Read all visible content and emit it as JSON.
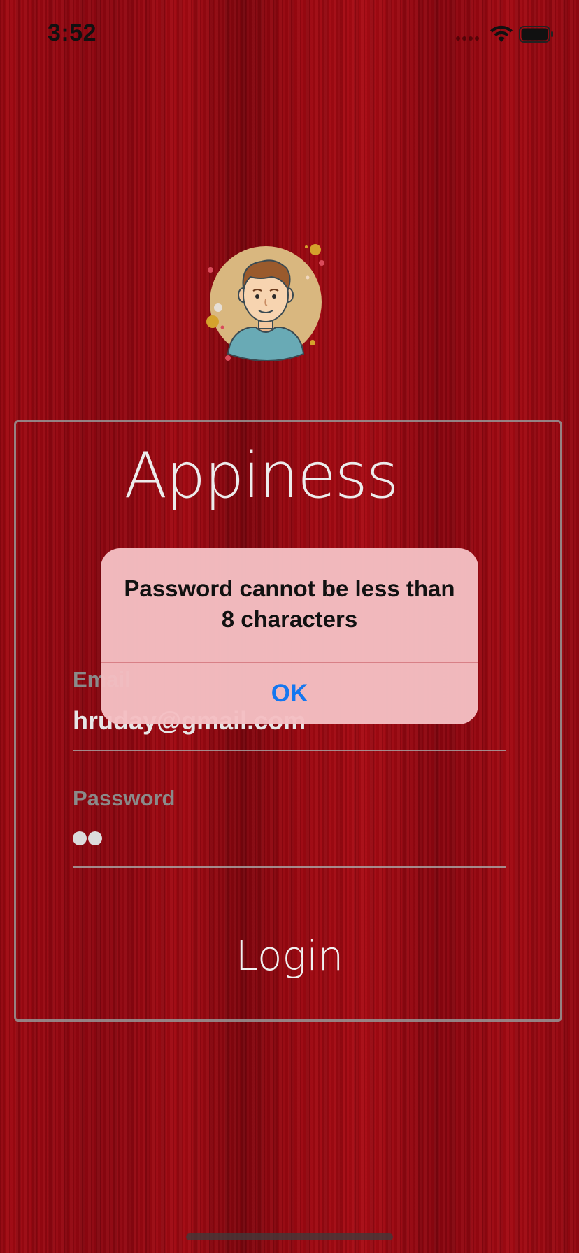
{
  "status_bar": {
    "time": "3:52",
    "icons": [
      "cellular-signal-icon",
      "wifi-icon",
      "battery-icon"
    ]
  },
  "app": {
    "title": "Appiness",
    "avatar": "user-avatar-illustration"
  },
  "form": {
    "email_label": "Email",
    "email_value": "hruday@gmail.com",
    "password_label": "Password",
    "password_masked_length": 2,
    "login_label": "Login"
  },
  "alert": {
    "message": "Password cannot be less than 8 characters",
    "ok_label": "OK"
  },
  "colors": {
    "background": "#9e0710",
    "alert_background": "#f4bec2",
    "alert_button": "#1477f0",
    "field_label": "#8a8a8a"
  }
}
